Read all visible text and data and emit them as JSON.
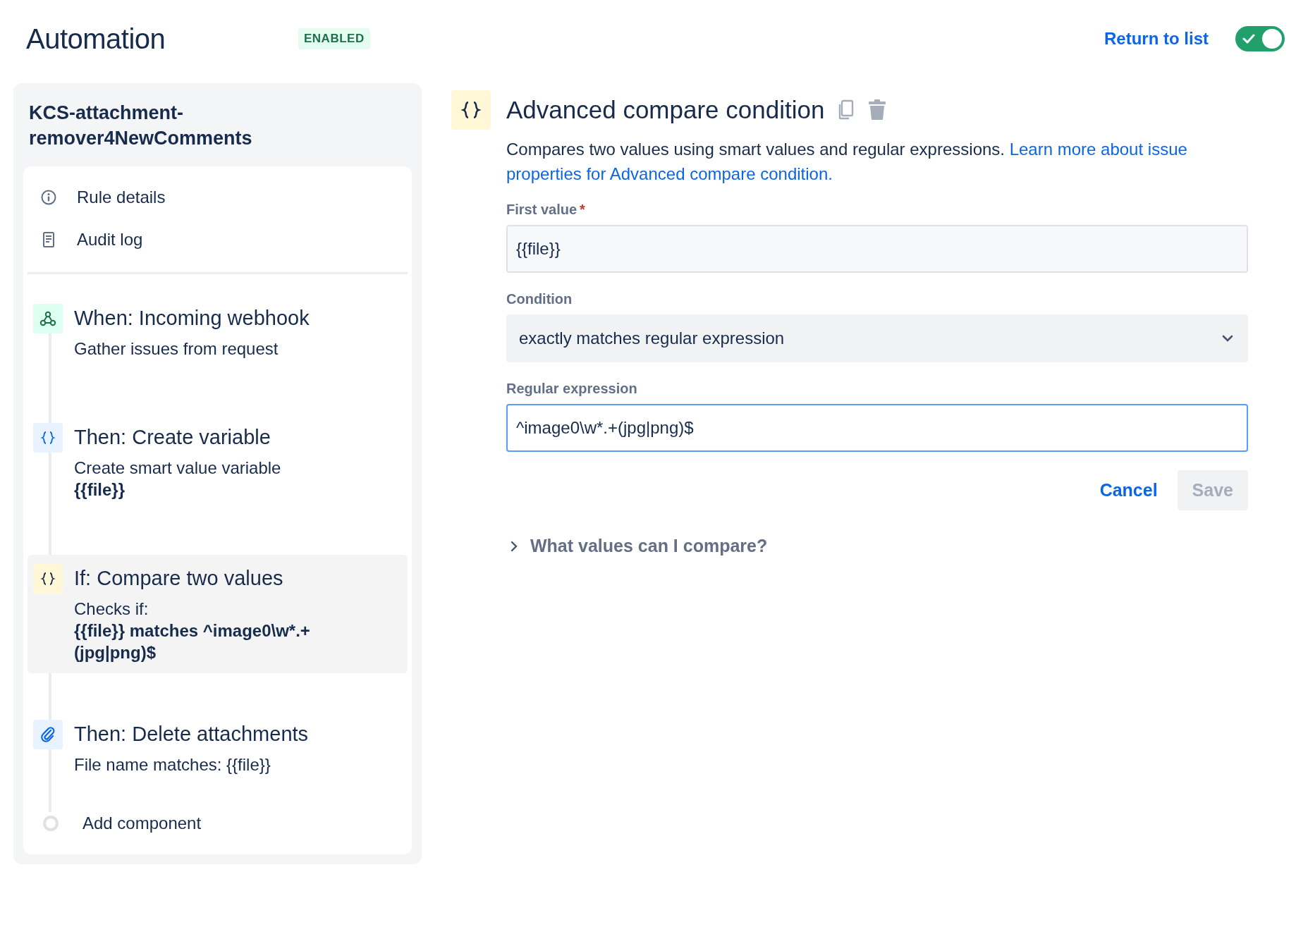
{
  "header": {
    "title": "Automation",
    "status_badge": "ENABLED",
    "return_link": "Return to list",
    "enabled_toggle": {
      "on": true
    }
  },
  "sidebar": {
    "rule_name": "KCS-attachment-remover4NewComments",
    "nav_items": [
      {
        "kind": "info",
        "label": "Rule details"
      },
      {
        "kind": "log",
        "label": "Audit log"
      }
    ],
    "steps": [
      {
        "kind": "webhook",
        "title": "When: Incoming webhook",
        "selected": false,
        "lines": [
          {
            "text": "Gather issues from request",
            "bold": false
          }
        ]
      },
      {
        "kind": "variable",
        "title": "Then: Create variable",
        "selected": false,
        "lines": [
          {
            "text": "Create smart value variable",
            "bold": false
          },
          {
            "text": "{{file}}",
            "bold": true
          }
        ]
      },
      {
        "kind": "condition",
        "title": "If: Compare two values",
        "selected": true,
        "lines": [
          {
            "text": "Checks if:",
            "bold": false
          },
          {
            "text": "{{file}} matches ^image0\\w*.+(jpg|png)$",
            "bold": true
          }
        ]
      },
      {
        "kind": "attachment",
        "title": "Then: Delete attachments",
        "selected": false,
        "lines": [
          {
            "text": "File name matches: {{file}}",
            "bold": false
          }
        ]
      }
    ],
    "add_component": "Add component"
  },
  "editor": {
    "title": "Advanced compare condition",
    "description": "Compares two values using smart values and regular expressions.",
    "learn_more_link_lines": [
      "Learn more about issue",
      "properties for Advanced compare condition."
    ],
    "fields": [
      {
        "kind": "input",
        "label": "First value",
        "required_mark": "*",
        "value": "{{file}}",
        "focused": false
      },
      {
        "kind": "select",
        "label": "Condition",
        "value": "exactly matches regular expression"
      },
      {
        "kind": "input",
        "label": "Regular expression",
        "value": "^image0\\w*.+(jpg|png)$",
        "focused": true
      }
    ],
    "cancel_button": "Cancel",
    "save_button": {
      "label": "Save",
      "disabled": true
    },
    "help_expander": {
      "label": "What values can I compare?",
      "expanded": false
    }
  }
}
